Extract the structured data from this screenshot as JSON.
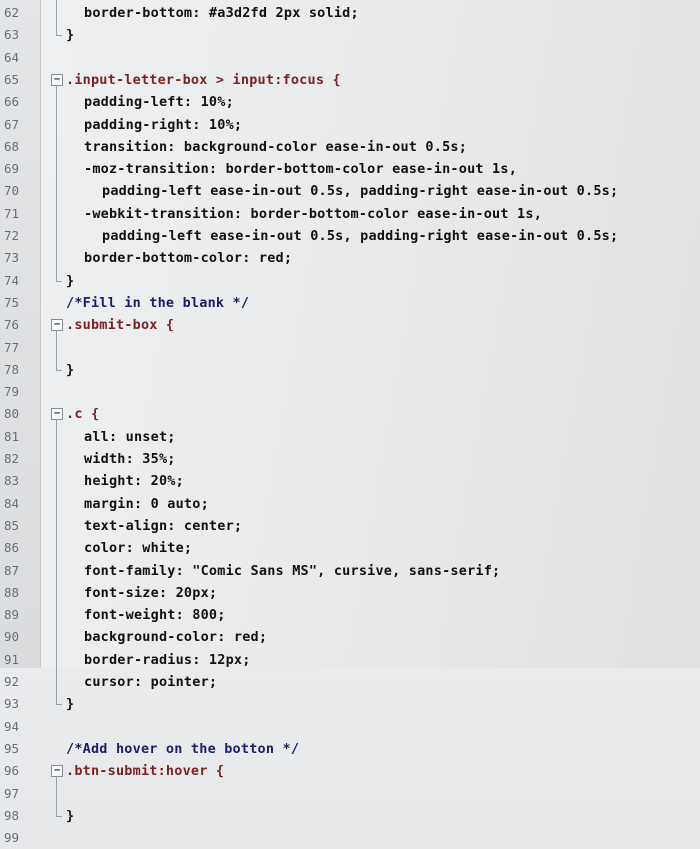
{
  "editor": {
    "lines": [
      {
        "num": "62",
        "text": "border-bottom: #a3d2fd 2px solid;",
        "indent": 1
      },
      {
        "num": "63",
        "text": "}",
        "indent": 0,
        "close": true
      },
      {
        "num": "64",
        "text": "",
        "indent": 0
      },
      {
        "num": "65",
        "text": ".input-letter-box > input:focus {",
        "indent": 0,
        "fold": true
      },
      {
        "num": "66",
        "text": "padding-left: 10%;",
        "indent": 1
      },
      {
        "num": "67",
        "text": "padding-right: 10%;",
        "indent": 1
      },
      {
        "num": "68",
        "text": "transition: background-color ease-in-out 0.5s;",
        "indent": 1
      },
      {
        "num": "69",
        "text": "-moz-transition: border-bottom-color ease-in-out 1s,",
        "indent": 1
      },
      {
        "num": "70",
        "text": "padding-left ease-in-out 0.5s, padding-right ease-in-out 0.5s;",
        "indent": 2
      },
      {
        "num": "71",
        "text": "-webkit-transition: border-bottom-color ease-in-out 1s,",
        "indent": 1
      },
      {
        "num": "72",
        "text": "padding-left ease-in-out 0.5s, padding-right ease-in-out 0.5s;",
        "indent": 2
      },
      {
        "num": "73",
        "text": "border-bottom-color: red;",
        "indent": 1
      },
      {
        "num": "74",
        "text": "}",
        "indent": 0,
        "close": true
      },
      {
        "num": "75",
        "text": "/*Fill in the blank */",
        "indent": 0,
        "comment": true
      },
      {
        "num": "76",
        "text": ".submit-box {",
        "indent": 0,
        "fold": true
      },
      {
        "num": "77",
        "text": "",
        "indent": 0
      },
      {
        "num": "78",
        "text": "}",
        "indent": 0,
        "close": true
      },
      {
        "num": "79",
        "text": "",
        "indent": 0
      },
      {
        "num": "80",
        "text": ".c {",
        "indent": 0,
        "fold": true
      },
      {
        "num": "81",
        "text": "all: unset;",
        "indent": 1
      },
      {
        "num": "82",
        "text": "width: 35%;",
        "indent": 1
      },
      {
        "num": "83",
        "text": "height: 20%;",
        "indent": 1
      },
      {
        "num": "84",
        "text": "margin: 0 auto;",
        "indent": 1
      },
      {
        "num": "85",
        "text": "text-align: center;",
        "indent": 1
      },
      {
        "num": "86",
        "text": "color: white;",
        "indent": 1
      },
      {
        "num": "87",
        "text": "font-family: \"Comic Sans MS\", cursive, sans-serif;",
        "indent": 1
      },
      {
        "num": "88",
        "text": "font-size: 20px;",
        "indent": 1
      },
      {
        "num": "89",
        "text": "font-weight: 800;",
        "indent": 1
      },
      {
        "num": "90",
        "text": "background-color: red;",
        "indent": 1
      },
      {
        "num": "91",
        "text": "border-radius: 12px;",
        "indent": 1
      },
      {
        "num": "92",
        "text": "cursor: pointer;",
        "indent": 1
      },
      {
        "num": "93",
        "text": "}",
        "indent": 0,
        "close": true
      },
      {
        "num": "94",
        "text": "",
        "indent": 0
      },
      {
        "num": "95",
        "text": "/*Add hover on the botton */",
        "indent": 0,
        "comment": true
      },
      {
        "num": "96",
        "text": ".btn-submit:hover {",
        "indent": 0,
        "fold": true
      },
      {
        "num": "97",
        "text": "",
        "indent": 0
      },
      {
        "num": "98",
        "text": "}",
        "indent": 0,
        "close": true
      },
      {
        "num": "99",
        "text": "",
        "indent": 0
      }
    ]
  }
}
